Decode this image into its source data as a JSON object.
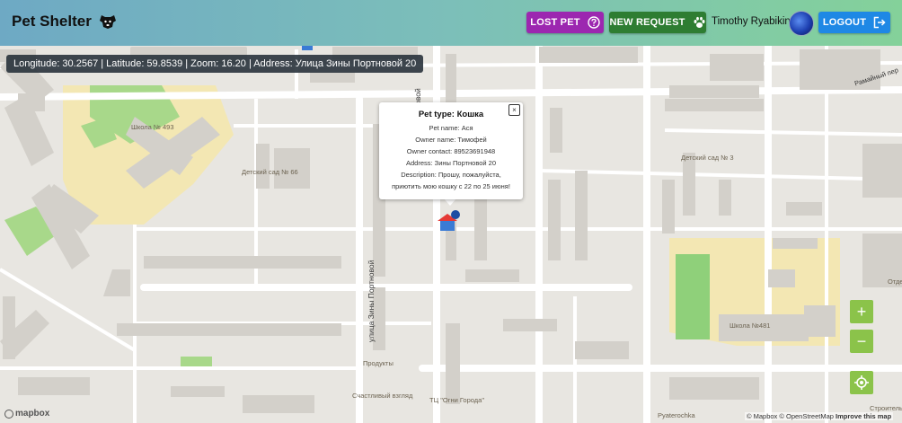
{
  "header": {
    "brand": "Pet Shelter",
    "lost_pet_label": "LOST PET",
    "new_request_label": "NEW REQUEST",
    "username": "Timothy Ryabikin",
    "logout_label": "LOGOUT"
  },
  "status": {
    "coords_text": "Longitude: 30.2567 | Latitude: 59.8539 | Zoom: 16.20 | Address: Улица Зины Портновой 20"
  },
  "popup": {
    "title": "Pet type: Кошка",
    "pet_name": "Pet name: Ася",
    "owner_name": "Owner name: Тимофей",
    "owner_contact": "Owner contact: 89523691948",
    "address": "Address: Зины Портновой 20",
    "description_1": "Description: Прошу, пожалуйста,",
    "description_2": "приютить мою кошку с 22 по 25 июня!",
    "close_label": "×"
  },
  "map_labels": {
    "school_493": "Школа № 493",
    "kindergarten_66": "Детский сад № 66",
    "kindergarten_3": "Детский сад № 3",
    "school_481": "Школа №481",
    "street_vertical": "улица Зины Портновой",
    "street_vertical_top": "а Зины Портновой",
    "street_top_right": "Рамайный пер",
    "produkty": "Продукты",
    "happy_look": "Счастливый взгляд",
    "tc_ogni": "ТЦ \"Огни Города\"",
    "pyaterochka": "Pyaterochka",
    "stroiteli": "Строитель",
    "otdel": "Отде"
  },
  "controls": {
    "zoom_in": "+",
    "zoom_out": "−"
  },
  "attribution": {
    "mapbox": "© Mapbox",
    "osm": "© OpenStreetMap",
    "improve": "Improve this map",
    "logo": "mapbox"
  },
  "colors": {
    "lost_pet": "#9c27b0",
    "new_request": "#2e7d32",
    "logout": "#1e88e5",
    "map_button": "#8bc34a"
  }
}
